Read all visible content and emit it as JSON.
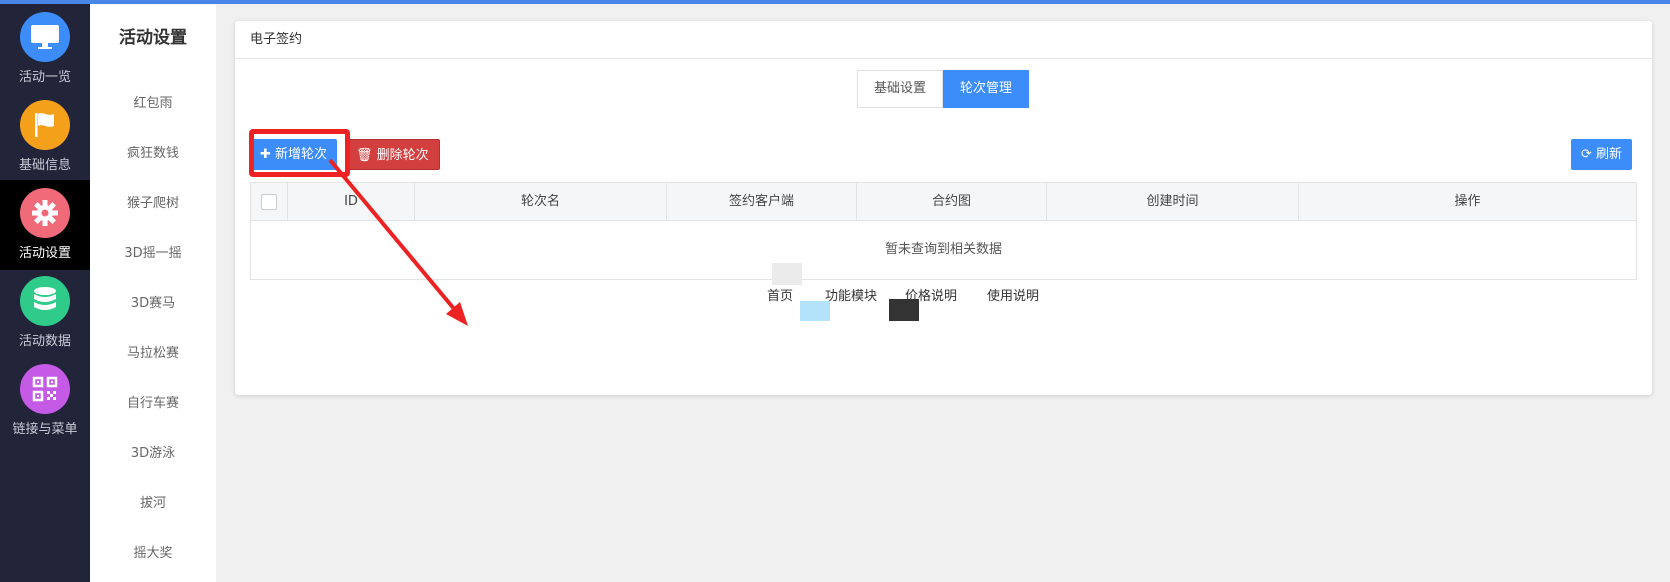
{
  "leftnav": {
    "items": [
      {
        "label": "活动一览",
        "icon": "monitor-icon",
        "color": "#3c8dfa"
      },
      {
        "label": "基础信息",
        "icon": "flag-icon",
        "color": "#f5a01a"
      },
      {
        "label": "活动设置",
        "icon": "gear-icon",
        "color": "#f06a7a"
      },
      {
        "label": "活动数据",
        "icon": "database-icon",
        "color": "#2ecb8a"
      },
      {
        "label": "链接与菜单",
        "icon": "qrcode-icon",
        "color": "#c45ae6"
      }
    ]
  },
  "subnav": {
    "title": "活动设置",
    "items": [
      "红包雨",
      "疯狂数钱",
      "猴子爬树",
      "3D摇一摇",
      "3D赛马",
      "马拉松赛",
      "自行车赛",
      "3D游泳",
      "拔河",
      "摇大奖"
    ]
  },
  "panel": {
    "title": "电子签约",
    "tabs": [
      {
        "label": "基础设置"
      },
      {
        "label": "轮次管理"
      }
    ],
    "toolbar": {
      "add_label": "新增轮次",
      "delete_label": "删除轮次",
      "refresh_label": "刷新"
    },
    "table": {
      "columns": [
        "ID",
        "轮次名",
        "签约客户端",
        "合约图",
        "创建时间",
        "操作"
      ],
      "empty_text": "暂未查询到相关数据"
    },
    "footer_links": [
      "首页",
      "功能模块",
      "价格说明",
      "使用说明"
    ]
  }
}
